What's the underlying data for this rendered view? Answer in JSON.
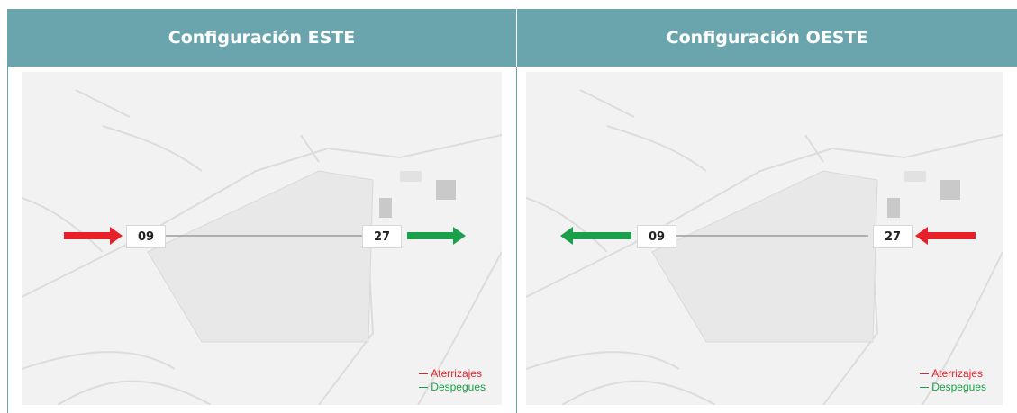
{
  "panels": [
    {
      "title": "Configuración ESTE",
      "runway_left": "09",
      "runway_right": "27",
      "left_arrow": {
        "direction": "right",
        "color": "#e8202a"
      },
      "right_arrow": {
        "direction": "right",
        "color": "#1aa04a"
      }
    },
    {
      "title": "Configuración OESTE",
      "runway_left": "09",
      "runway_right": "27",
      "left_arrow": {
        "direction": "left",
        "color": "#1aa04a"
      },
      "right_arrow": {
        "direction": "left",
        "color": "#e8202a"
      }
    }
  ],
  "legend": {
    "landings": "Aterrizajes",
    "takeoffs": "Despegues",
    "landings_color": "#e8202a",
    "takeoffs_color": "#1aa04a"
  },
  "colors": {
    "header_bg": "#6aa5ae",
    "map_bg": "#f2f2f2"
  }
}
